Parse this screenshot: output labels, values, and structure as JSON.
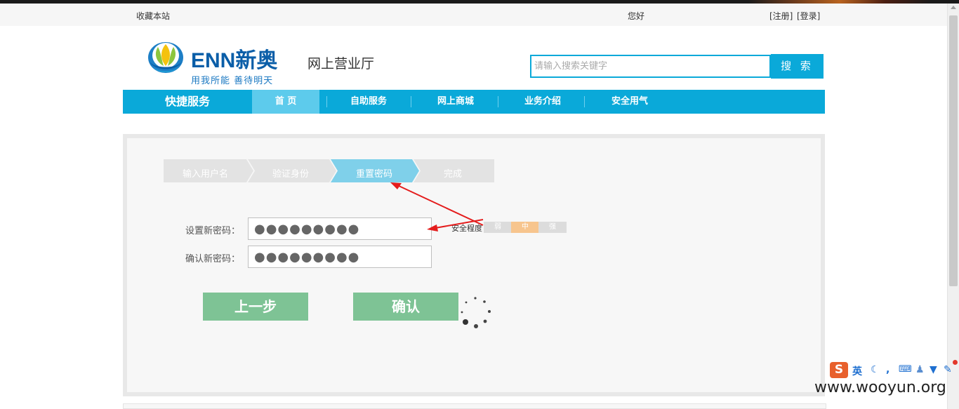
{
  "topbar": {
    "bookmark": "收藏本站",
    "greeting": "您好",
    "register": "[注册]",
    "login": "[登录]"
  },
  "header": {
    "brand": "ENN新奥",
    "slogan": "用我所能 善待明天",
    "title": "网上营业厅"
  },
  "search": {
    "placeholder": "请输入搜索关键字",
    "button": "搜 索"
  },
  "nav": {
    "quick": "快捷服务",
    "items": [
      "首 页",
      "自助服务",
      "网上商城",
      "业务介绍",
      "安全用气"
    ],
    "active_index": 0
  },
  "steps": {
    "items": [
      "输入用户名",
      "验证身份",
      "重置密码",
      "完成"
    ],
    "current_index": 2,
    "colors": {
      "inactive": "#e3e3e3",
      "active": "#7fd0ea"
    }
  },
  "form": {
    "new_password_label": "设置新密码：",
    "new_password_value": "●●●●●●●●●",
    "confirm_password_label": "确认新密码：",
    "confirm_password_value": "●●●●●●●●●",
    "strength_label": "安全程度",
    "strength_levels": [
      "弱",
      "中",
      "强"
    ],
    "strength_active_index": 1
  },
  "buttons": {
    "prev": "上一步",
    "confirm": "确认"
  },
  "ime": {
    "logo": "S",
    "mode": "英"
  },
  "watermark": "www.wooyun.org",
  "colors": {
    "accent": "#0aa9d9",
    "nav_active": "#5dcbec",
    "button_green": "#7ec395",
    "strength_active": "#f7c58e",
    "annotation_arrow": "#e41c1c"
  }
}
